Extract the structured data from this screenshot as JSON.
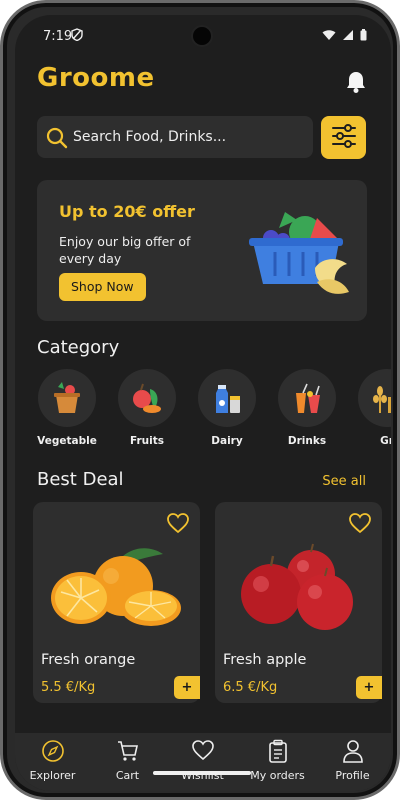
{
  "status_bar": {
    "time": "7:19"
  },
  "header": {
    "app_title": "Groome"
  },
  "search": {
    "placeholder": "Search Food, Drinks..."
  },
  "banner": {
    "title": "Up to 20€ offer",
    "text": "Enjoy our big offer of every day",
    "button_label": "Shop Now"
  },
  "category": {
    "title": "Category",
    "items": [
      {
        "label": "Vegetable",
        "icon": "vegetable-basket-icon"
      },
      {
        "label": "Fruits",
        "icon": "fruits-icon"
      },
      {
        "label": "Dairy",
        "icon": "dairy-icon"
      },
      {
        "label": "Drinks",
        "icon": "drinks-icon"
      },
      {
        "label": "Gr",
        "icon": "grains-icon"
      }
    ]
  },
  "best_deal": {
    "title": "Best Deal",
    "see_all": "See all",
    "products": [
      {
        "name": "Fresh orange",
        "price": "5.5 €/Kg",
        "add_label": "+"
      },
      {
        "name": "Fresh apple",
        "price": "6.5 €/Kg",
        "add_label": "+"
      }
    ]
  },
  "bottom_nav": {
    "items": [
      {
        "label": "Explorer",
        "icon": "compass-icon"
      },
      {
        "label": "Cart",
        "icon": "cart-icon"
      },
      {
        "label": "Wishlist",
        "icon": "heart-icon"
      },
      {
        "label": "My orders",
        "icon": "clipboard-icon"
      },
      {
        "label": "Profile",
        "icon": "user-icon"
      }
    ]
  },
  "colors": {
    "accent": "#f2c230",
    "background": "#1e1e1e",
    "surface": "#2e2e2e"
  }
}
